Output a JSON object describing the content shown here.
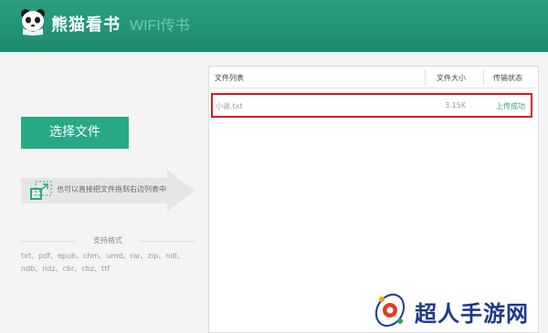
{
  "header": {
    "brand": "熊猫看书",
    "subtitle": "WIFI传书",
    "logo_icon": "panda-logo-icon"
  },
  "left": {
    "select_button": "选择文件",
    "drag_hint": "也可以直接把文件拖到右边列表中",
    "drag_icon": "resize-arrow-icon",
    "formats_title": "支持格式",
    "formats": "txt、pdf、epub、chm、umd、rar、zip、ndl、ndb、ndz、cbr、cbz、ttf"
  },
  "table": {
    "headers": [
      "文件列表",
      "文件大小",
      "传输状态"
    ],
    "rows": [
      {
        "name": "小说.txt",
        "size": "3.15K",
        "status": "上传成功"
      }
    ]
  },
  "watermark": {
    "text": "超人手游网",
    "icon": "watermark-logo-icon"
  },
  "colors": {
    "accent": "#27a886",
    "header": "#1f8a70",
    "highlight_border": "#e0161c",
    "status_success": "#2aa886"
  }
}
